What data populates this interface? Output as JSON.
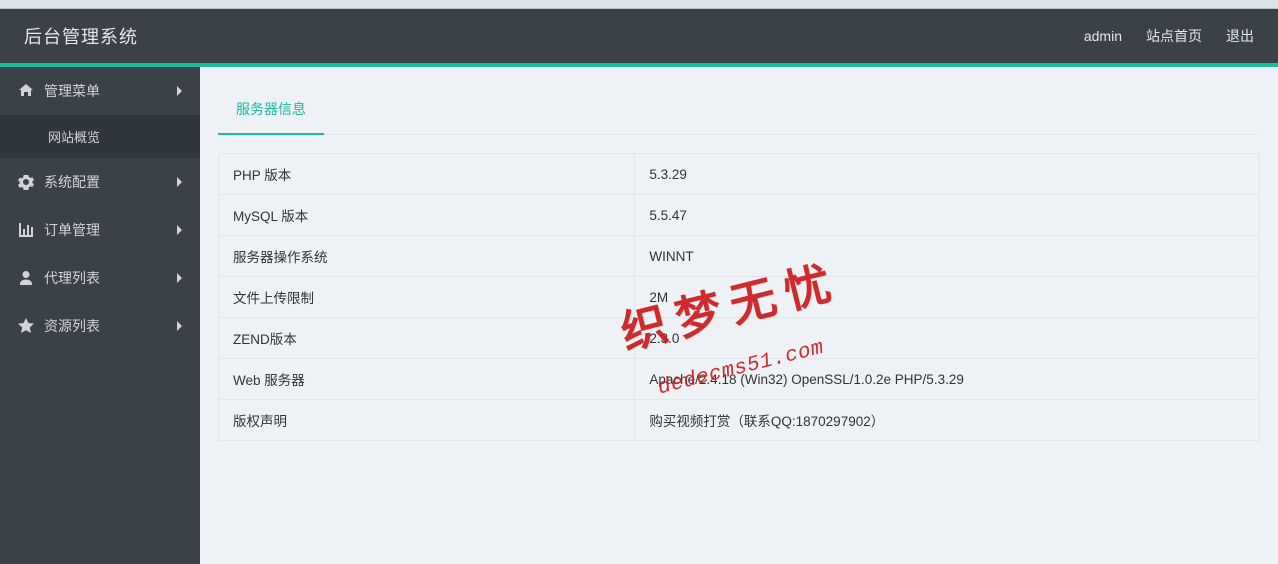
{
  "header": {
    "title": "后台管理系统",
    "user": "admin",
    "site_home": "站点首页",
    "logout": "退出"
  },
  "sidebar": {
    "items": [
      {
        "label": "管理菜单",
        "icon": "home-icon"
      },
      {
        "label": "系统配置",
        "icon": "cogs-icon"
      },
      {
        "label": "订单管理",
        "icon": "chart-icon"
      },
      {
        "label": "代理列表",
        "icon": "user-icon"
      },
      {
        "label": "资源列表",
        "icon": "star-icon"
      }
    ],
    "active_sub": "网站概览"
  },
  "panel": {
    "title": "服务器信息",
    "rows": [
      {
        "key": "PHP 版本",
        "val": "5.3.29"
      },
      {
        "key": "MySQL 版本",
        "val": "5.5.47"
      },
      {
        "key": "服务器操作系统",
        "val": "WINNT"
      },
      {
        "key": "文件上传限制",
        "val": "2M"
      },
      {
        "key": "ZEND版本",
        "val": "2.3.0"
      },
      {
        "key": "Web 服务器",
        "val": "Apache/2.4.18 (Win32) OpenSSL/1.0.2e PHP/5.3.29"
      },
      {
        "key": "版权声明",
        "val": "购买视频打赏（联系QQ:1870297902）"
      }
    ]
  },
  "watermark": {
    "main": "织梦无忧",
    "sub": "dedecms51.com"
  }
}
